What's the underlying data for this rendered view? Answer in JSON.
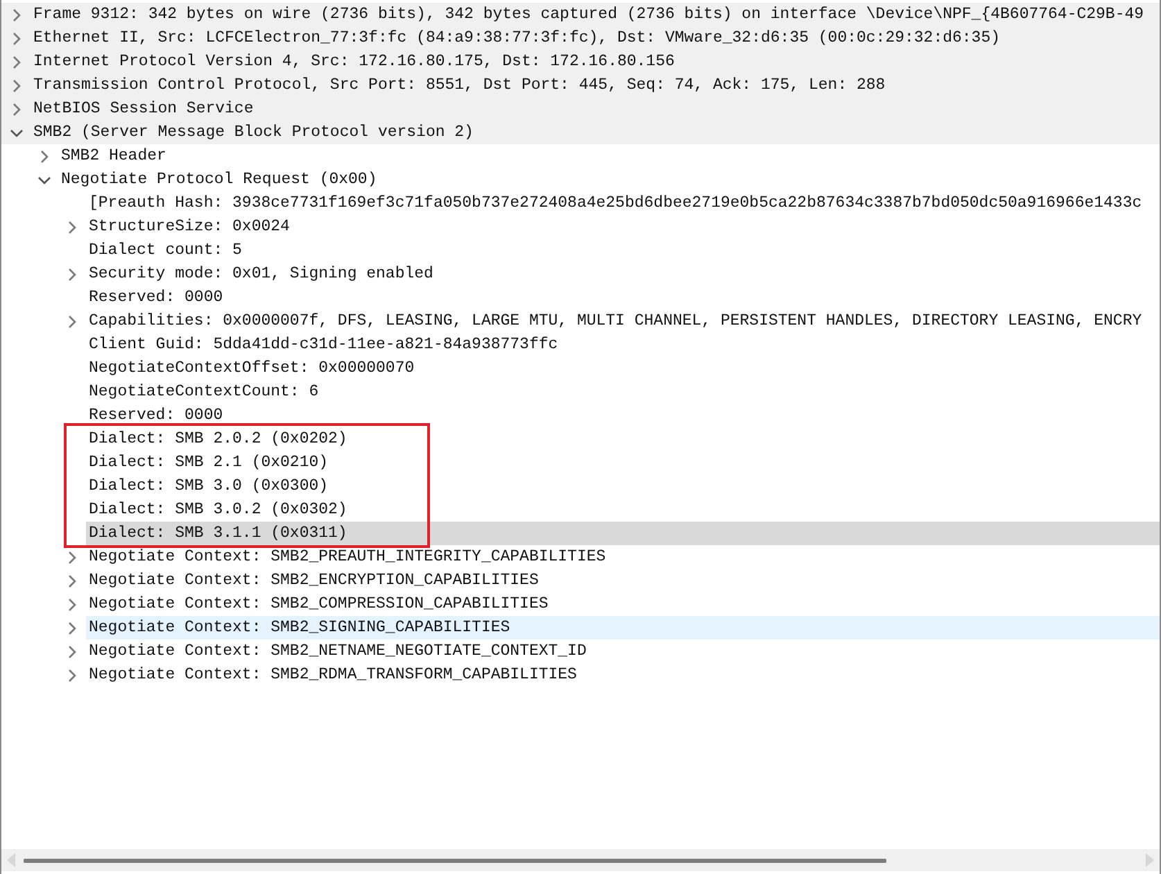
{
  "tree": [
    {
      "text": "Frame 9312: 342 bytes on wire (2736 bits), 342 bytes captured (2736 bits) on interface \\Device\\NPF_{4B607764-C29B-49",
      "expanded": false,
      "shaded": true
    },
    {
      "text": "Ethernet II, Src: LCFCElectron_77:3f:fc (84:a9:38:77:3f:fc), Dst: VMware_32:d6:35 (00:0c:29:32:d6:35)",
      "expanded": false,
      "shaded": true
    },
    {
      "text": "Internet Protocol Version 4, Src: 172.16.80.175, Dst: 172.16.80.156",
      "expanded": false,
      "shaded": true
    },
    {
      "text": "Transmission Control Protocol, Src Port: 8551, Dst Port: 445, Seq: 74, Ack: 175, Len: 288",
      "expanded": false,
      "shaded": true
    },
    {
      "text": "NetBIOS Session Service",
      "expanded": false,
      "shaded": true
    },
    {
      "text": "SMB2 (Server Message Block Protocol version 2)",
      "expanded": true,
      "shaded": true,
      "children": [
        {
          "text": "SMB2 Header",
          "expanded": false
        },
        {
          "text": "Negotiate Protocol Request (0x00)",
          "expanded": true,
          "children": [
            {
              "text": "[Preauth Hash: 3938ce7731f169ef3c71fa050b737e272408a4e25bd6dbee2719e0b5ca22b87634c3387b7bd050dc50a916966e1433c"
            },
            {
              "text": "StructureSize: 0x0024",
              "expanded": false
            },
            {
              "text": "Dialect count: 5"
            },
            {
              "text": "Security mode: 0x01, Signing enabled",
              "expanded": false
            },
            {
              "text": "Reserved: 0000"
            },
            {
              "text": "Capabilities: 0x0000007f, DFS, LEASING, LARGE MTU, MULTI CHANNEL, PERSISTENT HANDLES, DIRECTORY LEASING, ENCRY",
              "expanded": false
            },
            {
              "text": "Client Guid: 5dda41dd-c31d-11ee-a821-84a938773ffc"
            },
            {
              "text": "NegotiateContextOffset: 0x00000070"
            },
            {
              "text": "NegotiateContextCount: 6"
            },
            {
              "text": "Reserved: 0000"
            },
            {
              "text": "Dialect: SMB 2.0.2 (0x0202)",
              "boxed": true
            },
            {
              "text": "Dialect: SMB 2.1 (0x0210)",
              "boxed": true
            },
            {
              "text": "Dialect: SMB 3.0 (0x0300)",
              "boxed": true
            },
            {
              "text": "Dialect: SMB 3.0.2 (0x0302)",
              "boxed": true
            },
            {
              "text": "Dialect: SMB 3.1.1 (0x0311)",
              "boxed": true,
              "selected": true
            },
            {
              "text": "Negotiate Context: SMB2_PREAUTH_INTEGRITY_CAPABILITIES",
              "expanded": false
            },
            {
              "text": "Negotiate Context: SMB2_ENCRYPTION_CAPABILITIES",
              "expanded": false
            },
            {
              "text": "Negotiate Context: SMB2_COMPRESSION_CAPABILITIES",
              "expanded": false
            },
            {
              "text": "Negotiate Context: SMB2_SIGNING_CAPABILITIES",
              "expanded": false,
              "hovered": true
            },
            {
              "text": "Negotiate Context: SMB2_NETNAME_NEGOTIATE_CONTEXT_ID",
              "expanded": false
            },
            {
              "text": "Negotiate Context: SMB2_RDMA_TRANSFORM_CAPABILITIES",
              "expanded": false
            }
          ]
        }
      ]
    }
  ]
}
